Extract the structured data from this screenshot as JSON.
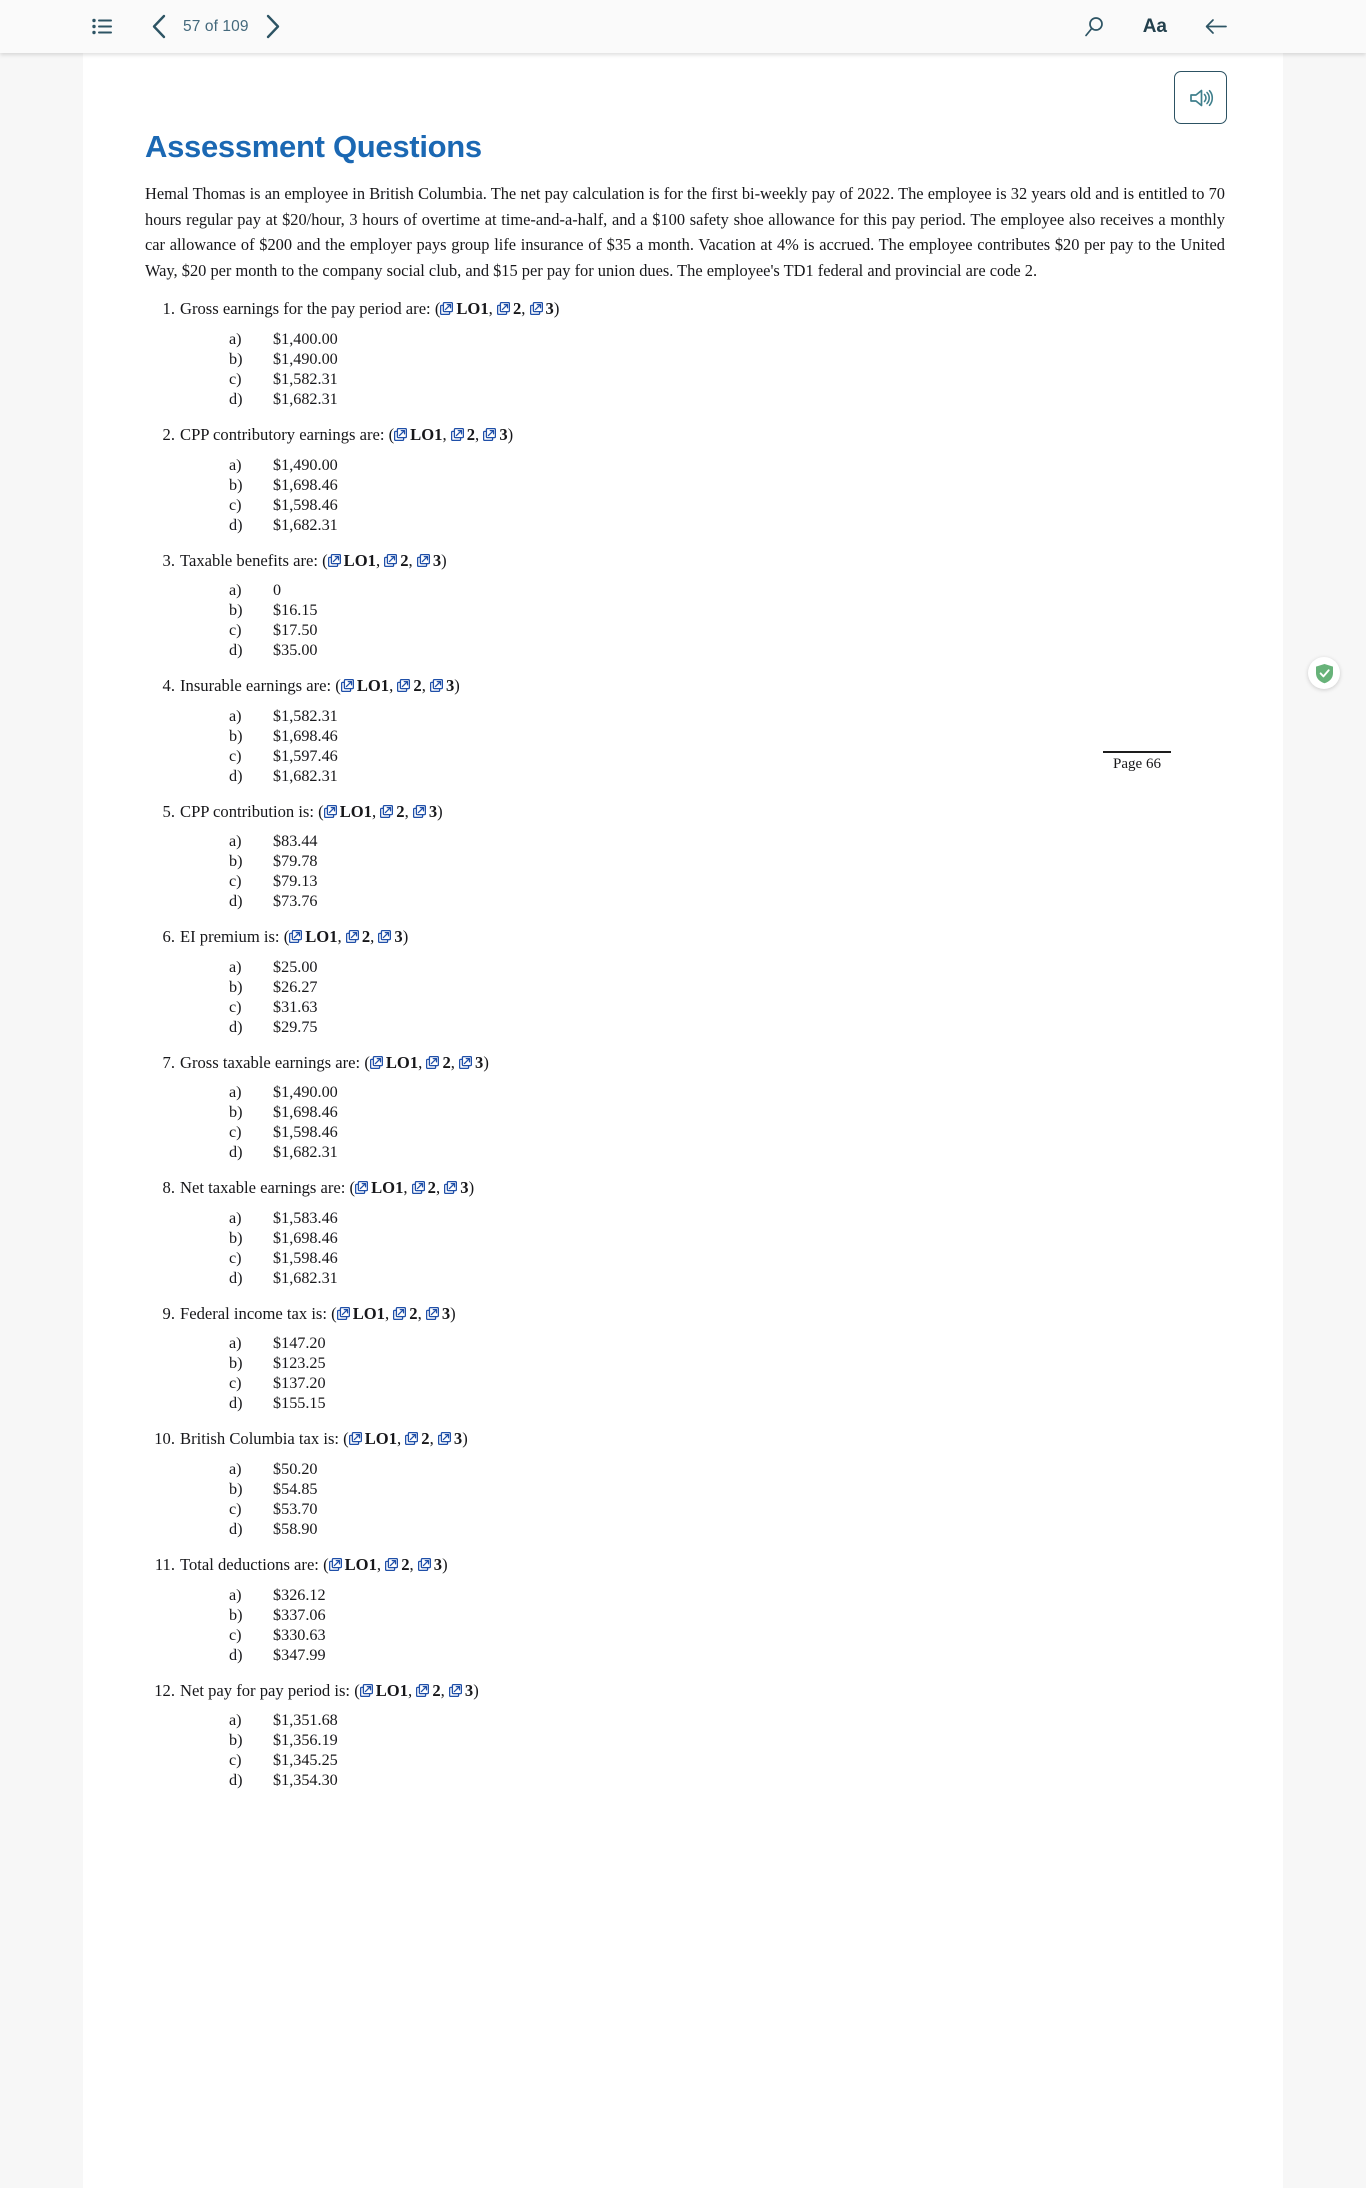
{
  "toolbar": {
    "toc_icon": "list-bullet-icon",
    "prev_icon": "chevron-left-icon",
    "next_icon": "chevron-right-icon",
    "page_indicator": "57 of 109",
    "search_icon": "search-icon",
    "text_size_label": "Aa",
    "back_icon": "back-arrow-icon",
    "audio_icon": "speaker-icon"
  },
  "document": {
    "title": "Assessment Questions",
    "intro": "Hemal Thomas is an employee in British Columbia. The net pay calculation is for the first bi-weekly pay of 2022. The employee is 32 years old and is entitled to 70 hours regular pay at $20/hour, 3 hours of overtime at time-and-a-half, and a $100 safety shoe allowance for this pay period. The employee also receives a monthly car allowance of $200 and the employer pays group life insurance of $35 a month. Vacation at 4% is accrued. The employee contributes $20 per pay to the United Way, $20 per month to the company social club, and $15 per pay for union dues. The employee's TD1 federal and provincial are code 2.",
    "page_marker": "Page 66",
    "ref_labels": [
      "LO1",
      "2",
      "3"
    ],
    "questions": [
      {
        "number": "1.",
        "text": "Gross earnings for the pay period are:",
        "options": [
          {
            "label": "a)",
            "value": "$1,400.00"
          },
          {
            "label": "b)",
            "value": "$1,490.00"
          },
          {
            "label": "c)",
            "value": "$1,582.31"
          },
          {
            "label": "d)",
            "value": "$1,682.31"
          }
        ]
      },
      {
        "number": "2.",
        "text": "CPP contributory earnings are:",
        "options": [
          {
            "label": "a)",
            "value": "$1,490.00"
          },
          {
            "label": "b)",
            "value": "$1,698.46"
          },
          {
            "label": "c)",
            "value": "$1,598.46"
          },
          {
            "label": "d)",
            "value": "$1,682.31"
          }
        ]
      },
      {
        "number": "3.",
        "text": "Taxable benefits are:",
        "options": [
          {
            "label": "a)",
            "value": "0"
          },
          {
            "label": "b)",
            "value": "$16.15"
          },
          {
            "label": "c)",
            "value": "$17.50"
          },
          {
            "label": "d)",
            "value": "$35.00"
          }
        ]
      },
      {
        "number": "4.",
        "text": "Insurable earnings are:",
        "options": [
          {
            "label": "a)",
            "value": "$1,582.31"
          },
          {
            "label": "b)",
            "value": "$1,698.46"
          },
          {
            "label": "c)",
            "value": "$1,597.46"
          },
          {
            "label": "d)",
            "value": "$1,682.31"
          }
        ]
      },
      {
        "number": "5.",
        "text": "CPP contribution is:",
        "options": [
          {
            "label": "a)",
            "value": "$83.44"
          },
          {
            "label": "b)",
            "value": "$79.78"
          },
          {
            "label": "c)",
            "value": "$79.13"
          },
          {
            "label": "d)",
            "value": "$73.76"
          }
        ]
      },
      {
        "number": "6.",
        "text": "EI premium is:",
        "options": [
          {
            "label": "a)",
            "value": "$25.00"
          },
          {
            "label": "b)",
            "value": "$26.27"
          },
          {
            "label": "c)",
            "value": "$31.63"
          },
          {
            "label": "d)",
            "value": "$29.75"
          }
        ]
      },
      {
        "number": "7.",
        "text": "Gross taxable earnings are:",
        "options": [
          {
            "label": "a)",
            "value": "$1,490.00"
          },
          {
            "label": "b)",
            "value": "$1,698.46"
          },
          {
            "label": "c)",
            "value": "$1,598.46"
          },
          {
            "label": "d)",
            "value": "$1,682.31"
          }
        ]
      },
      {
        "number": "8.",
        "text": "Net taxable earnings are:",
        "options": [
          {
            "label": "a)",
            "value": "$1,583.46"
          },
          {
            "label": "b)",
            "value": "$1,698.46"
          },
          {
            "label": "c)",
            "value": "$1,598.46"
          },
          {
            "label": "d)",
            "value": "$1,682.31"
          }
        ]
      },
      {
        "number": "9.",
        "text": "Federal income tax is:",
        "options": [
          {
            "label": "a)",
            "value": "$147.20"
          },
          {
            "label": "b)",
            "value": "$123.25"
          },
          {
            "label": "c)",
            "value": "$137.20"
          },
          {
            "label": "d)",
            "value": "$155.15"
          }
        ]
      },
      {
        "number": "10.",
        "text": "British Columbia tax is:",
        "options": [
          {
            "label": "a)",
            "value": "$50.20"
          },
          {
            "label": "b)",
            "value": "$54.85"
          },
          {
            "label": "c)",
            "value": "$53.70"
          },
          {
            "label": "d)",
            "value": "$58.90"
          }
        ]
      },
      {
        "number": "11.",
        "text": "Total deductions are:",
        "options": [
          {
            "label": "a)",
            "value": "$326.12"
          },
          {
            "label": "b)",
            "value": "$337.06"
          },
          {
            "label": "c)",
            "value": "$330.63"
          },
          {
            "label": "d)",
            "value": "$347.99"
          }
        ]
      },
      {
        "number": "12.",
        "text": "Net pay for pay period is:",
        "options": [
          {
            "label": "a)",
            "value": "$1,351.68"
          },
          {
            "label": "b)",
            "value": "$1,356.19"
          },
          {
            "label": "c)",
            "value": "$1,345.25"
          },
          {
            "label": "d)",
            "value": "$1,354.30"
          }
        ]
      }
    ]
  },
  "overlay": {
    "shield_icon": "adguard-shield-check-icon"
  },
  "colors": {
    "title_blue": "#1b68b3",
    "toolbar_text": "#44697c",
    "link_icon_blue": "#1f4fa8",
    "shield_green": "#67b279",
    "page_bg": "#ffffff",
    "app_bg": "#f7f7f7"
  }
}
